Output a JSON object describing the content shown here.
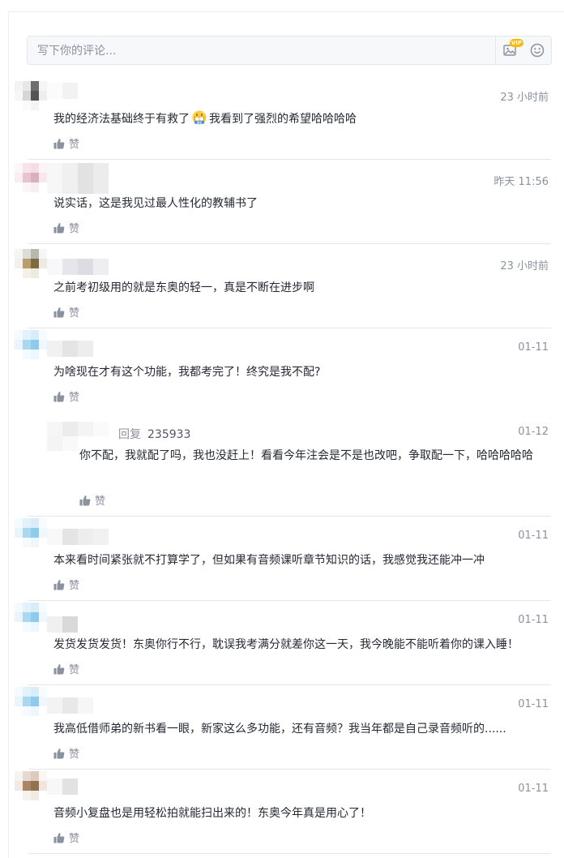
{
  "input": {
    "placeholder": "写下你的评论...",
    "vip_badge": "VIP",
    "image_icon": "image-icon",
    "emoji_icon": "smile-icon"
  },
  "like_label": "赞",
  "comments": [
    {
      "time": "23 小时前",
      "text_a": "我的经济法基础终于有救了",
      "emoji": "grin-emoji",
      "emoji_label": "要命",
      "text_b": "我看到了强烈的希望哈哈哈哈"
    },
    {
      "time": "昨天 11:56",
      "text": "说实话，这是我见过最人性化的教辅书了"
    },
    {
      "time": "23 小时前",
      "text": "之前考初级用的就是东奥的轻一，真是不断在进步啊"
    },
    {
      "time": "01-11",
      "text": "为啥现在才有这个功能，我都考完了！终究是我不配?"
    },
    {
      "time": "01-11",
      "text": "本来看时间紧张就不打算学了，但如果有音频课听章节知识的话，我感觉我还能冲一冲"
    },
    {
      "time": "01-11",
      "text": "发货发货发货！东奥你行不行，耽误我考满分就差你这一天，我今晚能不能听着你的课入睡！"
    },
    {
      "time": "01-11",
      "text": "我高低借师弟的新书看一眼，新家这么多功能，还有音频？我当年都是自己录音频听的......"
    },
    {
      "time": "01-11",
      "text": "音频小复盘也是用轻松拍就能扫出来的！东奥今年真是用心了！"
    }
  ],
  "reply": {
    "label": "回复",
    "target": "235933",
    "time": "01-12",
    "text": "你不配，我就配了吗，我也没赶上！看看今年注会是不是也改吧，争取配一下，哈哈哈哈哈"
  },
  "colors": {
    "text": "#252933",
    "muted": "#8a919f",
    "divider": "#e4e6eb"
  }
}
